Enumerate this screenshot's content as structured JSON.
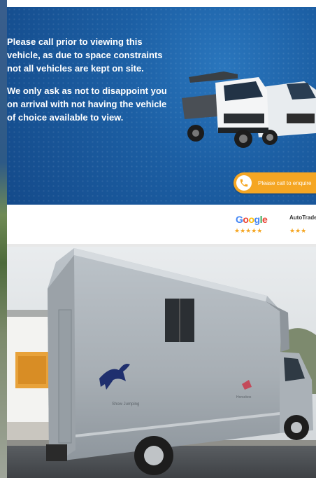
{
  "banner": {
    "paragraph1": "Please call prior to viewing this vehicle, as due to space constraints not all vehicles are kept on site.",
    "paragraph2": "We only ask as not to disappoint you on arrival with not having the vehicle of choice available to view.",
    "cta_label": "Please call to enquire",
    "cta_icon": "phone-icon"
  },
  "ratings": {
    "google_label": "Google",
    "google_stars": "★★★★★",
    "autotrader_label": "AutoTrader",
    "autotrader_stars": "★★★"
  },
  "photo": {
    "livery_text_left": "Show Jumping",
    "livery_text_right": "Horsebox"
  },
  "colors": {
    "banner_blue": "#1c5fa4",
    "cta_orange": "#f5a623",
    "vehicle_silver": "#a9b0b6"
  }
}
